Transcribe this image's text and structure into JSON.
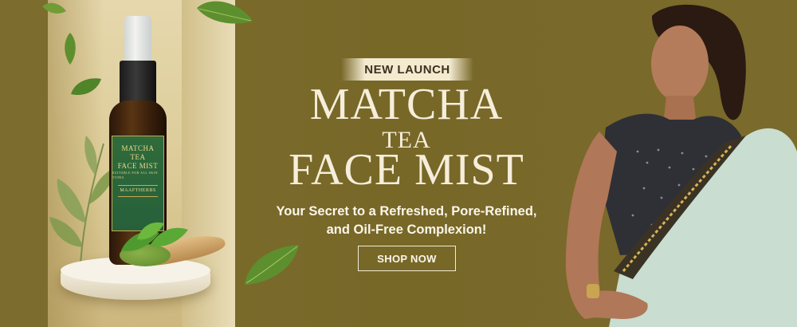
{
  "banner": {
    "badge": "NEW LAUNCH",
    "title_line1": "MATCHA",
    "title_line2": "TEA",
    "title_line3": "FACE MIST",
    "tagline_line1": "Your Secret to a Refreshed, Pore-Refined,",
    "tagline_line2": "and Oil-Free Complexion!",
    "cta_label": "SHOP NOW"
  },
  "product_label": {
    "line1": "MATCHA",
    "line2": "TEA",
    "line3": "FACE MIST",
    "subline": "SUITABLE FOR ALL SKIN TYPES",
    "brand": "MAAFTHERBS"
  },
  "colors": {
    "background": "#7a6a2c",
    "text_light": "#f6eedb",
    "badge_bg": "#f3ead0",
    "leaf_green": "#5e8f2e"
  },
  "icons": [
    "leaf-icon",
    "spray-bottle-icon"
  ]
}
